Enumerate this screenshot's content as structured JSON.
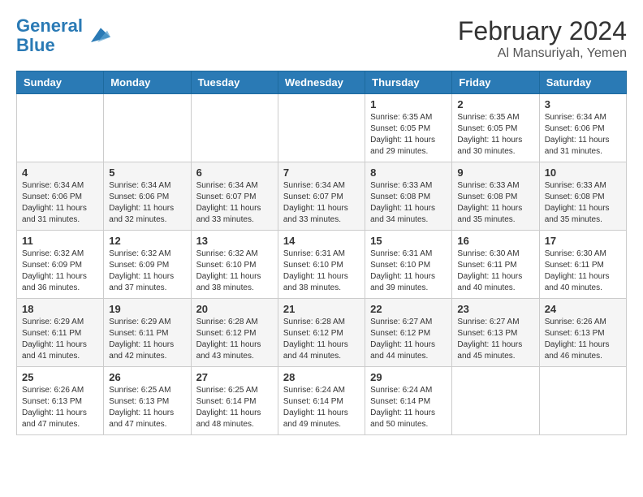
{
  "header": {
    "logo_line1": "General",
    "logo_line2": "Blue",
    "month": "February 2024",
    "location": "Al Mansuriyah, Yemen"
  },
  "days_of_week": [
    "Sunday",
    "Monday",
    "Tuesday",
    "Wednesday",
    "Thursday",
    "Friday",
    "Saturday"
  ],
  "weeks": [
    [
      {
        "day": "",
        "info": ""
      },
      {
        "day": "",
        "info": ""
      },
      {
        "day": "",
        "info": ""
      },
      {
        "day": "",
        "info": ""
      },
      {
        "day": "1",
        "info": "Sunrise: 6:35 AM\nSunset: 6:05 PM\nDaylight: 11 hours and 29 minutes."
      },
      {
        "day": "2",
        "info": "Sunrise: 6:35 AM\nSunset: 6:05 PM\nDaylight: 11 hours and 30 minutes."
      },
      {
        "day": "3",
        "info": "Sunrise: 6:34 AM\nSunset: 6:06 PM\nDaylight: 11 hours and 31 minutes."
      }
    ],
    [
      {
        "day": "4",
        "info": "Sunrise: 6:34 AM\nSunset: 6:06 PM\nDaylight: 11 hours and 31 minutes."
      },
      {
        "day": "5",
        "info": "Sunrise: 6:34 AM\nSunset: 6:06 PM\nDaylight: 11 hours and 32 minutes."
      },
      {
        "day": "6",
        "info": "Sunrise: 6:34 AM\nSunset: 6:07 PM\nDaylight: 11 hours and 33 minutes."
      },
      {
        "day": "7",
        "info": "Sunrise: 6:34 AM\nSunset: 6:07 PM\nDaylight: 11 hours and 33 minutes."
      },
      {
        "day": "8",
        "info": "Sunrise: 6:33 AM\nSunset: 6:08 PM\nDaylight: 11 hours and 34 minutes."
      },
      {
        "day": "9",
        "info": "Sunrise: 6:33 AM\nSunset: 6:08 PM\nDaylight: 11 hours and 35 minutes."
      },
      {
        "day": "10",
        "info": "Sunrise: 6:33 AM\nSunset: 6:08 PM\nDaylight: 11 hours and 35 minutes."
      }
    ],
    [
      {
        "day": "11",
        "info": "Sunrise: 6:32 AM\nSunset: 6:09 PM\nDaylight: 11 hours and 36 minutes."
      },
      {
        "day": "12",
        "info": "Sunrise: 6:32 AM\nSunset: 6:09 PM\nDaylight: 11 hours and 37 minutes."
      },
      {
        "day": "13",
        "info": "Sunrise: 6:32 AM\nSunset: 6:10 PM\nDaylight: 11 hours and 38 minutes."
      },
      {
        "day": "14",
        "info": "Sunrise: 6:31 AM\nSunset: 6:10 PM\nDaylight: 11 hours and 38 minutes."
      },
      {
        "day": "15",
        "info": "Sunrise: 6:31 AM\nSunset: 6:10 PM\nDaylight: 11 hours and 39 minutes."
      },
      {
        "day": "16",
        "info": "Sunrise: 6:30 AM\nSunset: 6:11 PM\nDaylight: 11 hours and 40 minutes."
      },
      {
        "day": "17",
        "info": "Sunrise: 6:30 AM\nSunset: 6:11 PM\nDaylight: 11 hours and 40 minutes."
      }
    ],
    [
      {
        "day": "18",
        "info": "Sunrise: 6:29 AM\nSunset: 6:11 PM\nDaylight: 11 hours and 41 minutes."
      },
      {
        "day": "19",
        "info": "Sunrise: 6:29 AM\nSunset: 6:11 PM\nDaylight: 11 hours and 42 minutes."
      },
      {
        "day": "20",
        "info": "Sunrise: 6:28 AM\nSunset: 6:12 PM\nDaylight: 11 hours and 43 minutes."
      },
      {
        "day": "21",
        "info": "Sunrise: 6:28 AM\nSunset: 6:12 PM\nDaylight: 11 hours and 44 minutes."
      },
      {
        "day": "22",
        "info": "Sunrise: 6:27 AM\nSunset: 6:12 PM\nDaylight: 11 hours and 44 minutes."
      },
      {
        "day": "23",
        "info": "Sunrise: 6:27 AM\nSunset: 6:13 PM\nDaylight: 11 hours and 45 minutes."
      },
      {
        "day": "24",
        "info": "Sunrise: 6:26 AM\nSunset: 6:13 PM\nDaylight: 11 hours and 46 minutes."
      }
    ],
    [
      {
        "day": "25",
        "info": "Sunrise: 6:26 AM\nSunset: 6:13 PM\nDaylight: 11 hours and 47 minutes."
      },
      {
        "day": "26",
        "info": "Sunrise: 6:25 AM\nSunset: 6:13 PM\nDaylight: 11 hours and 47 minutes."
      },
      {
        "day": "27",
        "info": "Sunrise: 6:25 AM\nSunset: 6:14 PM\nDaylight: 11 hours and 48 minutes."
      },
      {
        "day": "28",
        "info": "Sunrise: 6:24 AM\nSunset: 6:14 PM\nDaylight: 11 hours and 49 minutes."
      },
      {
        "day": "29",
        "info": "Sunrise: 6:24 AM\nSunset: 6:14 PM\nDaylight: 11 hours and 50 minutes."
      },
      {
        "day": "",
        "info": ""
      },
      {
        "day": "",
        "info": ""
      }
    ]
  ]
}
